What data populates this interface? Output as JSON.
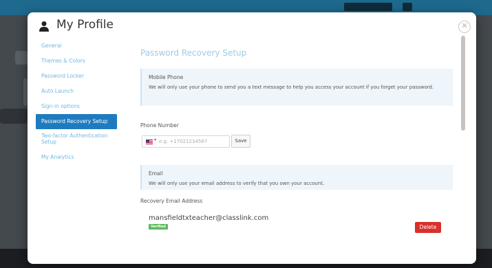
{
  "modal": {
    "title": "My Profile",
    "close_glyph": "✕",
    "icons": {
      "user": "user-icon",
      "close": "close-icon"
    }
  },
  "sidebar": {
    "items": [
      {
        "label": "General",
        "active": false
      },
      {
        "label": "Themes & Colors",
        "active": false
      },
      {
        "label": "Password Locker",
        "active": false
      },
      {
        "label": "Auto Launch",
        "active": false
      },
      {
        "label": "Sign-in options",
        "active": false
      },
      {
        "label": "Password Recovery Setup",
        "active": true
      },
      {
        "label": "Two-factor Authentication Setup",
        "active": false
      },
      {
        "label": "My Analytics",
        "active": false
      }
    ]
  },
  "content": {
    "title": "Password Recovery Setup",
    "mobile": {
      "heading": "Mobile Phone",
      "description": "We will only use your phone to send you a text message to help you access your account if you forget your password."
    },
    "phone": {
      "label": "Phone Number",
      "caret": "▾",
      "placeholder": "e.g. +17021234567",
      "save_label": "Save"
    },
    "email": {
      "heading": "Email",
      "description": "We will only use your email address to verify that you own your account."
    },
    "recovery_email": {
      "label": "Recovery Email Address",
      "address": "mansfieldtxteacher@classlink.com",
      "badge": "Verified",
      "delete_label": "Delete"
    }
  },
  "colors": {
    "accent": "#1f7bbf",
    "link": "#6fb7e0",
    "verified": "#5cb85c",
    "danger": "#d9302b"
  }
}
